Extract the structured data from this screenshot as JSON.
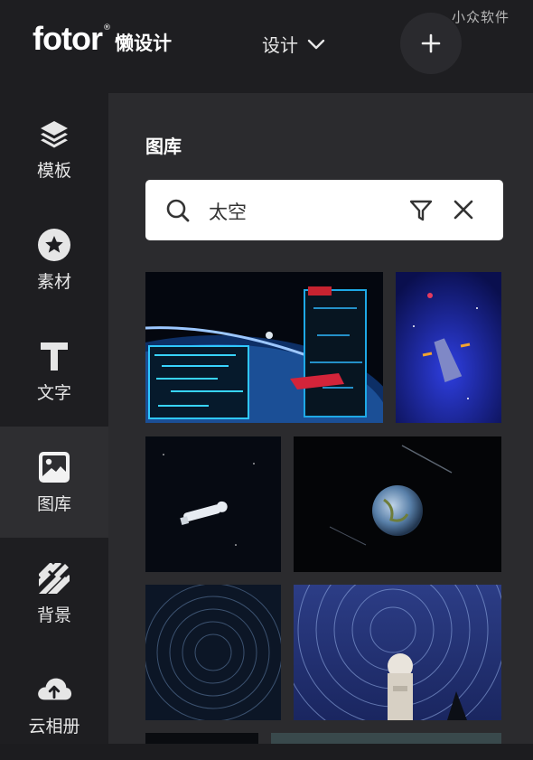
{
  "header": {
    "logo_text": "fotor",
    "logo_reg": "®",
    "logo_sub": "懒设计",
    "design_menu_label": "设计",
    "watermark": "小众软件"
  },
  "sidebar": {
    "items": [
      {
        "label": "模板",
        "icon": "layers-icon"
      },
      {
        "label": "素材",
        "icon": "star-circle-icon"
      },
      {
        "label": "文字",
        "icon": "text-t-icon"
      },
      {
        "label": "图库",
        "icon": "image-icon",
        "active": true
      },
      {
        "label": "背景",
        "icon": "stripes-icon"
      },
      {
        "label": "云相册",
        "icon": "cloud-upload-icon"
      }
    ]
  },
  "panel": {
    "title": "图库",
    "search": {
      "value": "太空"
    }
  },
  "colors": {
    "background": "#1c1c1f",
    "sidebar": "#1e1e21",
    "panel": "#2b2b2e",
    "active_item": "#2e2e31"
  }
}
